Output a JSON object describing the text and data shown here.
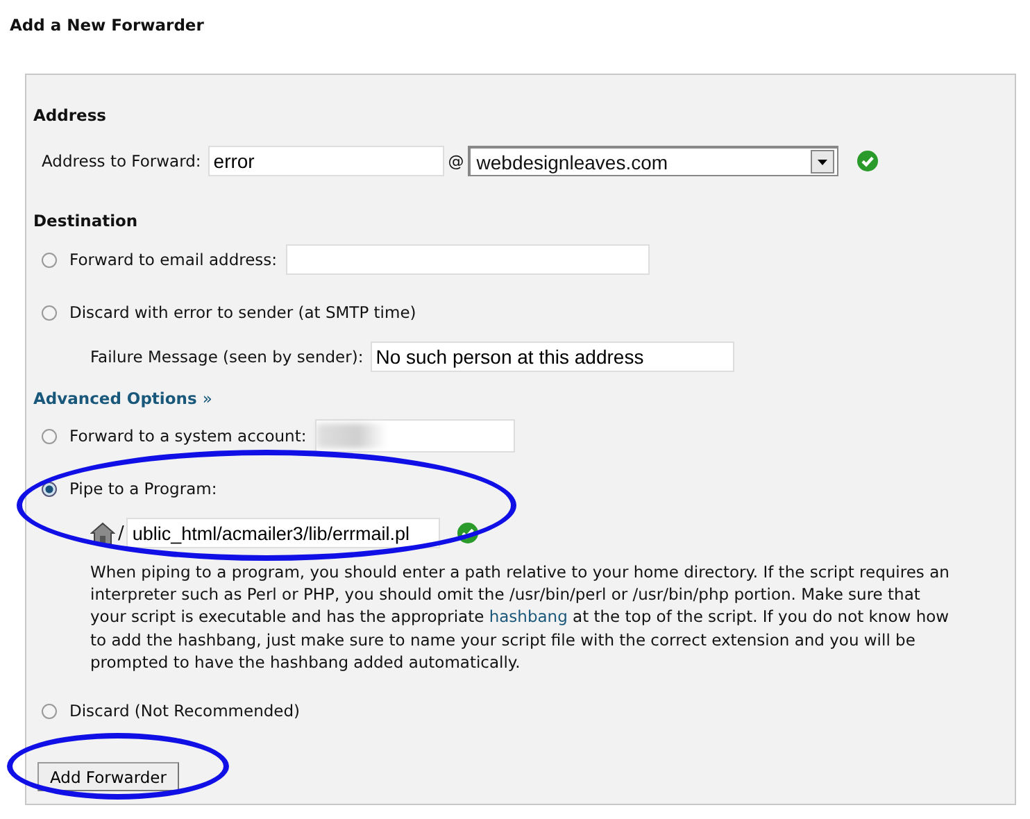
{
  "page_title": "Add a New Forwarder",
  "address": {
    "heading": "Address",
    "label": "Address to Forward:",
    "local_value": "error",
    "at": "@",
    "domain_value": "webdesignleaves.com",
    "valid": true
  },
  "destination": {
    "heading": "Destination",
    "options": [
      {
        "kind": "email",
        "label": "Forward to email address:",
        "selected": false
      },
      {
        "kind": "fail",
        "label": "Discard with error to sender (at SMTP time)",
        "selected": false,
        "sub_label": "Failure Message (seen by sender):",
        "value": "No such person at this address"
      }
    ]
  },
  "advanced": {
    "link": "Advanced Options",
    "link_arrow": "»",
    "options": [
      {
        "kind": "system",
        "label": "Forward to a system account:",
        "selected": false,
        "redacted": true
      },
      {
        "kind": "pipe",
        "label": "Pipe to a Program:",
        "selected": true,
        "slash": "/",
        "value": "ublic_html/acmailer3/lib/errmail.pl",
        "valid": true,
        "help_before": "When piping to a program, you should enter a path relative to your home directory. If the script requires an interpreter such as Perl or PHP, you should omit the /usr/bin/perl or /usr/bin/php portion. Make sure that your script is executable and has the appropriate",
        "help_link": "hashbang",
        "help_after": "at the top of the script. If you do not know how to add the hashbang, just make sure to name your script file with the correct extension and you will be prompted to have the hashbang added automatically."
      },
      {
        "kind": "discard",
        "label": "Discard (Not Recommended)",
        "selected": false
      }
    ]
  },
  "submit": "Add Forwarder",
  "annotations": [
    {
      "kind": "ellipse"
    },
    {
      "kind": "ellipse"
    }
  ]
}
